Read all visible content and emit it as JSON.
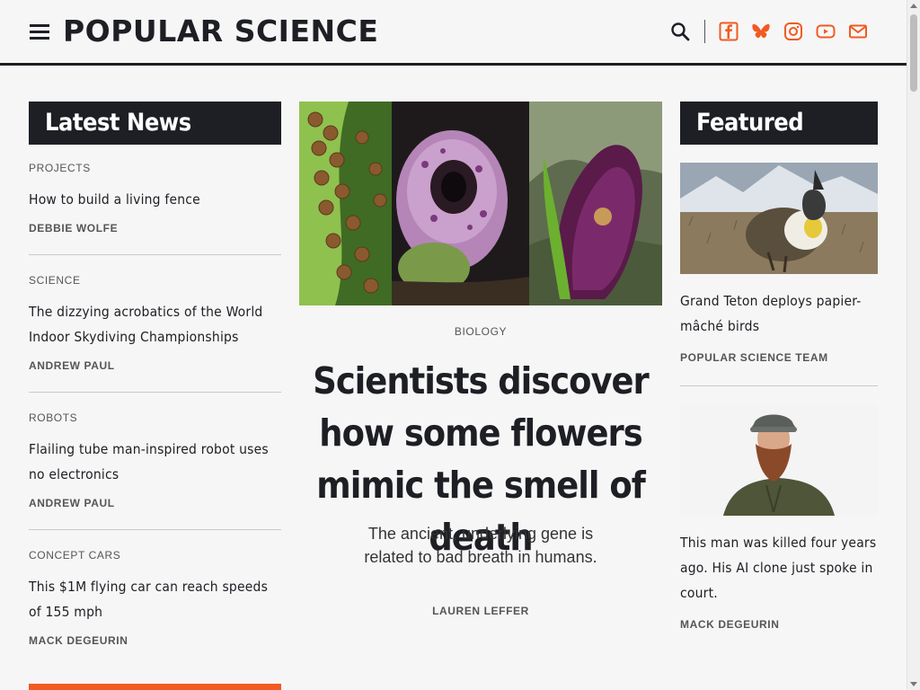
{
  "header": {
    "logo_text": "POPULAR SCIENCE",
    "menu_icon": "hamburger-menu-icon",
    "search_icon": "search-icon",
    "social_icons": [
      "facebook-icon",
      "bluesky-icon",
      "instagram-icon",
      "youtube-icon",
      "email-icon"
    ],
    "accent_color": "#f15a22"
  },
  "latest": {
    "heading": "Latest News",
    "items": [
      {
        "kicker": "PROJECTS",
        "title": "How to build a living fence",
        "byline": "DEBBIE WOLFE"
      },
      {
        "kicker": "SCIENCE",
        "title": "The dizzying acrobatics of the World Indoor Skydiving Championships",
        "byline": "ANDREW PAUL"
      },
      {
        "kicker": "ROBOTS",
        "title": "Flailing tube man-inspired robot uses no electronics",
        "byline": "ANDREW PAUL"
      },
      {
        "kicker": "CONCEPT CARS",
        "title": "This $1M flying car can reach speeds of 155 mph",
        "byline": "MACK DEGEURIN"
      }
    ]
  },
  "hero": {
    "kicker": "BIOLOGY",
    "title": "Scientists discover how some flowers mimic the smell of death",
    "dek": "The ancient, underlying gene is related to bad breath in humans.",
    "byline": "LAUREN LEFFER"
  },
  "featured": {
    "heading": "Featured",
    "items": [
      {
        "title": "Grand Teton deploys papier-mâché birds",
        "byline": "POPULAR SCIENCE TEAM"
      },
      {
        "title": "This man was killed four years ago. His AI clone just spoke in court.",
        "byline": "MACK DEGEURIN"
      }
    ]
  }
}
